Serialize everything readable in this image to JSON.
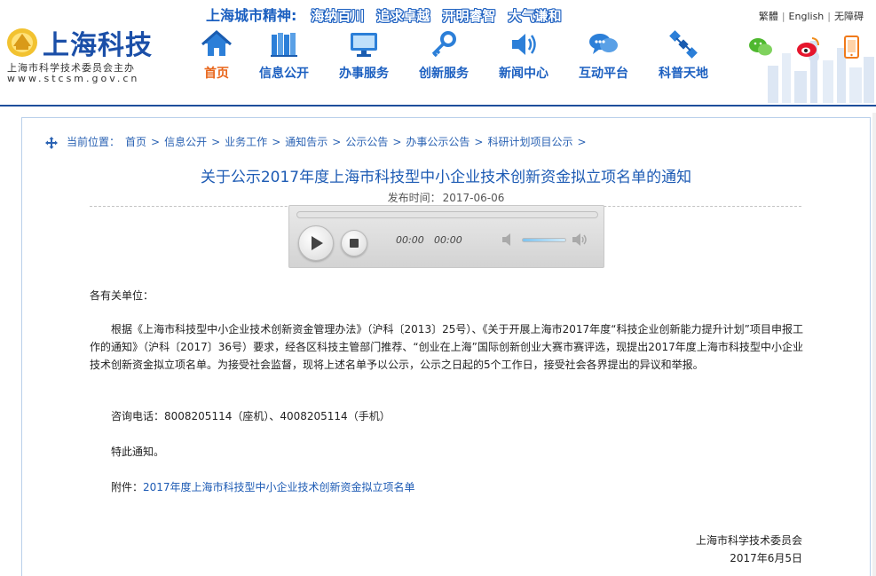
{
  "header": {
    "logo_title": "上海科技",
    "logo_sub": "上海市科学技术委员会主办",
    "logo_url": "www.stcsm.gov.cn",
    "slogan_lead": "上海城市精神:",
    "slogan_words": [
      "海纳百川",
      "追求卓越",
      "开明睿智",
      "大气谦和"
    ],
    "util_links": [
      "繁體",
      "English",
      "无障碍"
    ],
    "nav": [
      {
        "label": "首页",
        "icon": "home-icon",
        "active": true
      },
      {
        "label": "信息公开",
        "icon": "books-icon",
        "active": false
      },
      {
        "label": "办事服务",
        "icon": "monitor-icon",
        "active": false
      },
      {
        "label": "创新服务",
        "icon": "key-icon",
        "active": false
      },
      {
        "label": "新闻中心",
        "icon": "speaker-icon",
        "active": false
      },
      {
        "label": "互动平台",
        "icon": "chat-bubbles-icon",
        "active": false
      },
      {
        "label": "科普天地",
        "icon": "satellite-icon",
        "active": false
      }
    ],
    "social": [
      "wechat-icon",
      "weibo-icon",
      "mobile-icon"
    ],
    "colors": {
      "brand": "#1b5fc0",
      "active": "#e8651a",
      "bar": "#1e4f9c"
    }
  },
  "breadcrumb": {
    "lead": "当前位置：",
    "items": [
      "首页",
      "信息公开",
      "业务工作",
      "通知告示",
      "公示公告",
      "办事公示公告",
      "科研计划项目公示"
    ],
    "separator": ">"
  },
  "article": {
    "title": "关于公示2017年度上海市科技型中小企业技术创新资金拟立项名单的通知",
    "date_label": "发布时间：",
    "date": "2017-06-06",
    "salutation": "各有关单位：",
    "paragraph": "根据《上海市科技型中小企业技术创新资金管理办法》（沪科〔2013〕25号）、《关于开展上海市2017年度“科技企业创新能力提升计划”项目申报工作的通知》（沪科〔2017〕36号）要求，经各区科技主管部门推荐、“创业在上海”国际创新创业大赛市赛评选，现提出2017年度上海市科技型中小企业技术创新资金拟立项名单。为接受社会监督，现将上述名单予以公示，公示之日起的5个工作日，接受社会各界提出的异议和举报。",
    "contact": "咨询电话：8008205114（座机）、4008205114（手机）",
    "notice": "特此通知。",
    "attachment_label": "附件：",
    "attachment_link": "2017年度上海市科技型中小企业技术创新资金拟立项名单",
    "signature_org": "上海市科学技术委员会",
    "signature_date": "2017年6月5日"
  },
  "player": {
    "current_time": "00:00",
    "duration": "00:00",
    "progress": 0,
    "volume": 0.8
  }
}
